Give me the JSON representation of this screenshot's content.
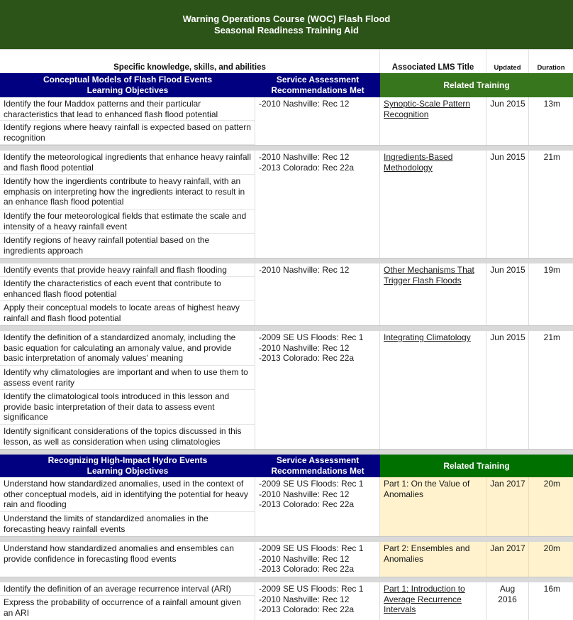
{
  "title": {
    "line1": "Warning Operations Course (WOC) Flash Flood",
    "line2": "Seasonal Readiness Training Aid"
  },
  "column_headers": {
    "ksa": "Specific knowledge, skills, and abilities",
    "lms_title": "Associated LMS Title",
    "updated": "Updated",
    "duration": "Duration"
  },
  "sections": [
    {
      "header_line1": "Conceptual Models of Flash Flood Events",
      "header_line2": "Learning Objectives",
      "service_line1": "Service Assessment",
      "service_line2": "Recommendations Met",
      "related": "Related Training",
      "groups": [
        {
          "objectives": [
            "Identify the four Maddox patterns and their particular characteristics that lead to enhanced flash flood potential",
            "Identify regions where heavy rainfall is expected based on pattern recognition"
          ],
          "recommendations": [
            "-2010 Nashville: Rec 12"
          ],
          "training": "Synoptic-Scale Pattern Recognition",
          "updated": "Jun 2015",
          "duration": "13m"
        },
        {
          "objectives": [
            "Identify the meteorological ingredients that enhance heavy rainfall and flash flood potential",
            "Identify how the ingerdients contribute to heavy rainfall, with an emphasis on interpreting how the ingredients interact to result in an enhance flash flood potential",
            "Identify the four meteorological fields that estimate the scale and intensity of a heavy rainfall event",
            "Identify regions of heavy rainfall potential based on the ingredients approach"
          ],
          "recommendations": [
            "-2010 Nashville: Rec 12",
            "-2013 Colorado: Rec 22a"
          ],
          "training": "Ingredients-Based Methodology",
          "updated": "Jun 2015",
          "duration": "21m"
        },
        {
          "objectives": [
            "Identify events that provide heavy rainfall and flash flooding",
            "Identify the characteristics of each event that contribute to enhanced flash flood potential",
            "Apply their conceptual models to locate areas of highest heavy rainfall and flash flood potential"
          ],
          "recommendations": [
            "-2010 Nashville: Rec 12"
          ],
          "training": "Other Mechanisms That Trigger Flash Floods",
          "updated": "Jun 2015",
          "duration": "19m"
        },
        {
          "objectives": [
            "Identify the definition of a standardized anomaly, including the basic equation for calculating an amonaly value, and provide basic interpretation of anomaly values' meaning",
            "Identify why climatologies are important and when to use them to assess event rarity",
            "Identify the climatological tools introduced in this lesson and provide basic interpretation of their data to assess event significance",
            "Identify significant considerations of the topics discussed in this lesson, as well as consideration when using climatologies"
          ],
          "recommendations": [
            "-2009 SE US Floods: Rec 1",
            "-2010 Nashville: Rec 12",
            "-2013 Colorado: Rec 22a"
          ],
          "training": "Integrating Climatology",
          "updated": "Jun 2015",
          "duration": "21m"
        }
      ]
    },
    {
      "header_line1": "Recognizing High-Impact Hydro Events",
      "header_line2": "Learning Objectives",
      "service_line1": "Service Assessment",
      "service_line2": "Recommendations Met",
      "related": "Related Training",
      "groups": [
        {
          "objectives": [
            "Understand how standardized anomalies, used in the context of other conceptual models, aid in identifying the potential for heavy rain and flooding",
            "Understand the limits of standardized anomalies in the forecasting heavy rainfall events"
          ],
          "recommendations": [
            "-2009 SE US Floods: Rec 1",
            "-2010 Nashville: Rec 12",
            "-2013 Colorado: Rec 22a"
          ],
          "training": "Part 1: On the Value of Anomalies",
          "updated": "Jan 2017",
          "duration": "20m"
        },
        {
          "objectives": [
            "Understand how standardized anomalies and ensembles can provide confidence in forecasting flood events"
          ],
          "recommendations": [
            "-2009 SE US Floods: Rec 1",
            "-2010 Nashville: Rec 12",
            "-2013 Colorado: Rec 22a"
          ],
          "training": "Part 2: Ensembles and Anomalies",
          "updated": "Jan 2017",
          "duration": "20m"
        },
        {
          "objectives": [
            "Identify the definition of an average recurrence interval (ARI)",
            "Express the probability of occurrence of a rainfall amount given an ARI"
          ],
          "recommendations": [
            "-2009 SE US Floods: Rec 1",
            "-2010 Nashville: Rec 12",
            "-2013 Colorado: Rec 22a"
          ],
          "training": "Part 1: Introduction to Average Recurrence Intervals",
          "updated": "Aug 2016",
          "duration": "16m"
        }
      ]
    }
  ]
}
